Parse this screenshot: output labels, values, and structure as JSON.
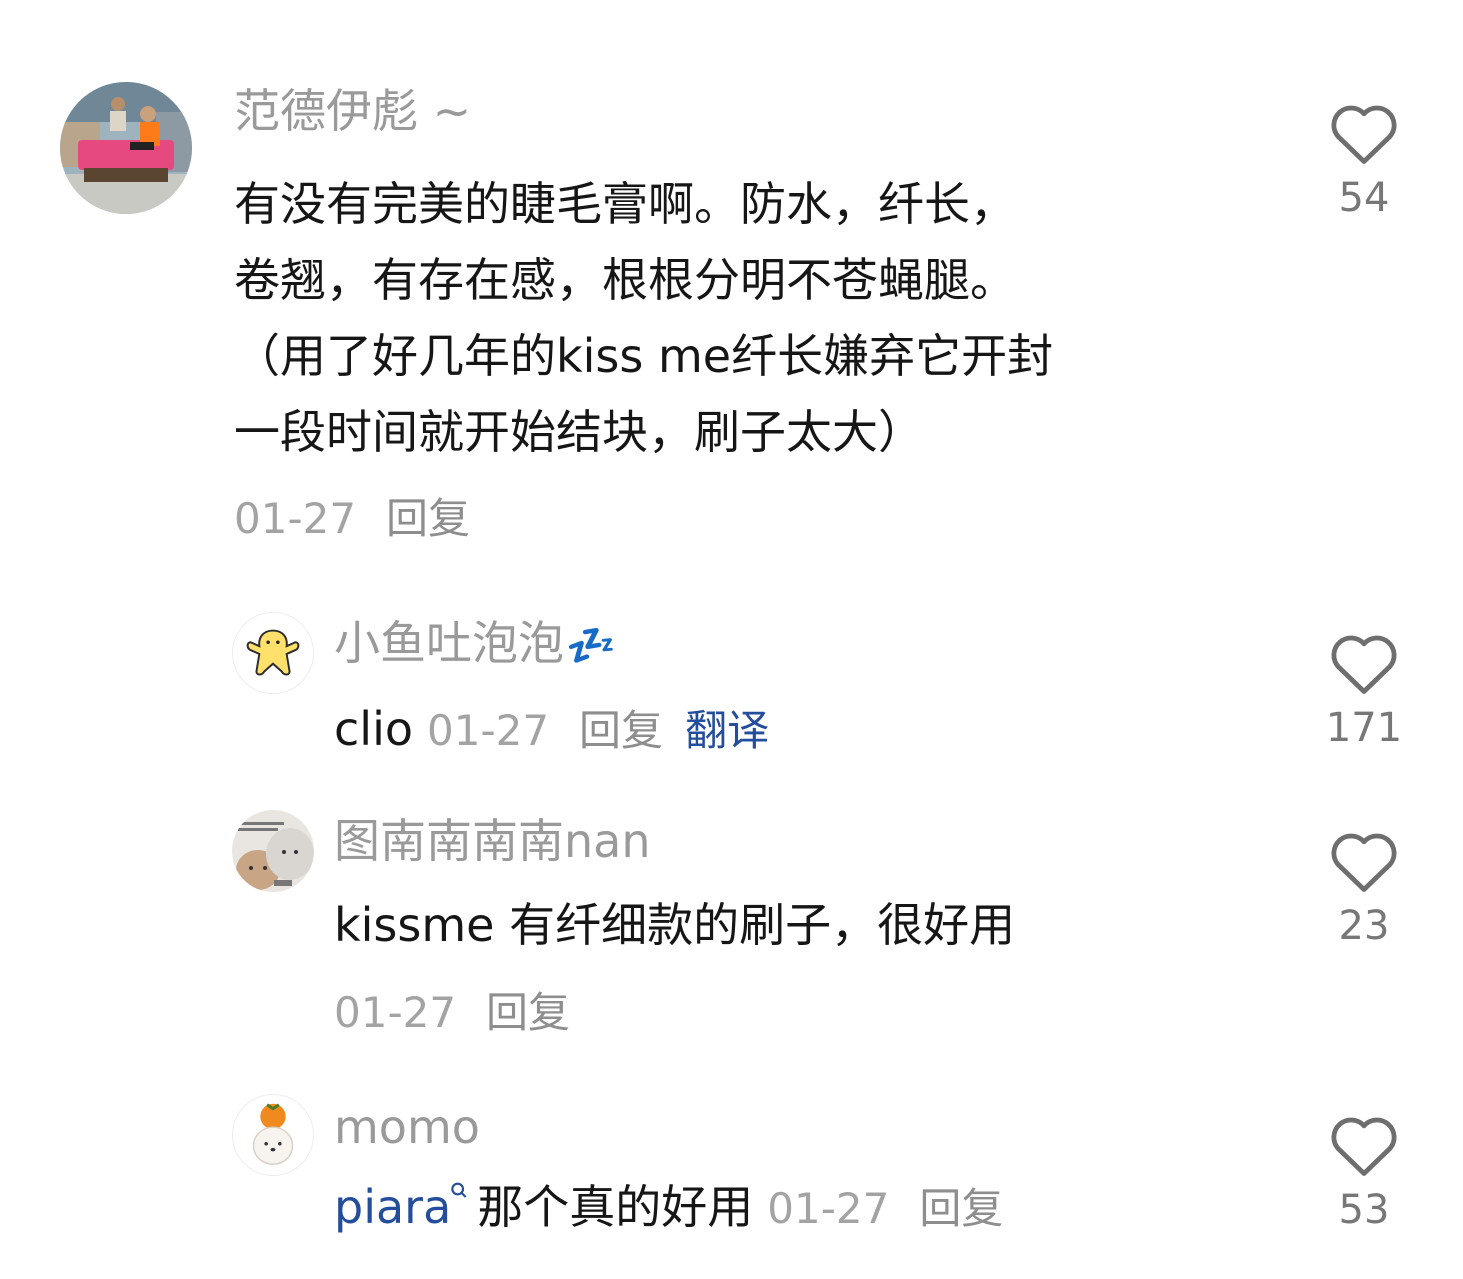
{
  "comments": [
    {
      "username": "范德伊彪 ~",
      "text_lines": [
        "有没有完美的睫毛膏啊。防水，纤长，",
        "卷翘，有存在感，根根分明不苍蝇腿。",
        "（用了好几年的kiss me纤长嫌弃它开封",
        "一段时间就开始结块，刷子太大）"
      ],
      "date": "01-27",
      "reply_label": "回复",
      "like_count": "54",
      "like_icon": "heart-outline-icon"
    }
  ],
  "replies": [
    {
      "username": "小鱼吐泡泡",
      "username_emoji": "💤",
      "text": "clio",
      "date": "01-27",
      "reply_label": "回复",
      "translate_label": "翻译",
      "like_count": "171"
    },
    {
      "username": "图南南南南nan",
      "text": "kissme 有纤细款的刷子，很好用",
      "date": "01-27",
      "reply_label": "回复",
      "like_count": "23"
    },
    {
      "username": "momo",
      "link_text": "piara",
      "link_icon": "search-icon",
      "text": "那个真的好用",
      "date": "01-27",
      "reply_label": "回复",
      "like_count": "53"
    }
  ],
  "colors": {
    "username": "#9a9a9a",
    "body_text": "#161616",
    "link": "#244e9b",
    "meta": "#a3a3a3"
  }
}
